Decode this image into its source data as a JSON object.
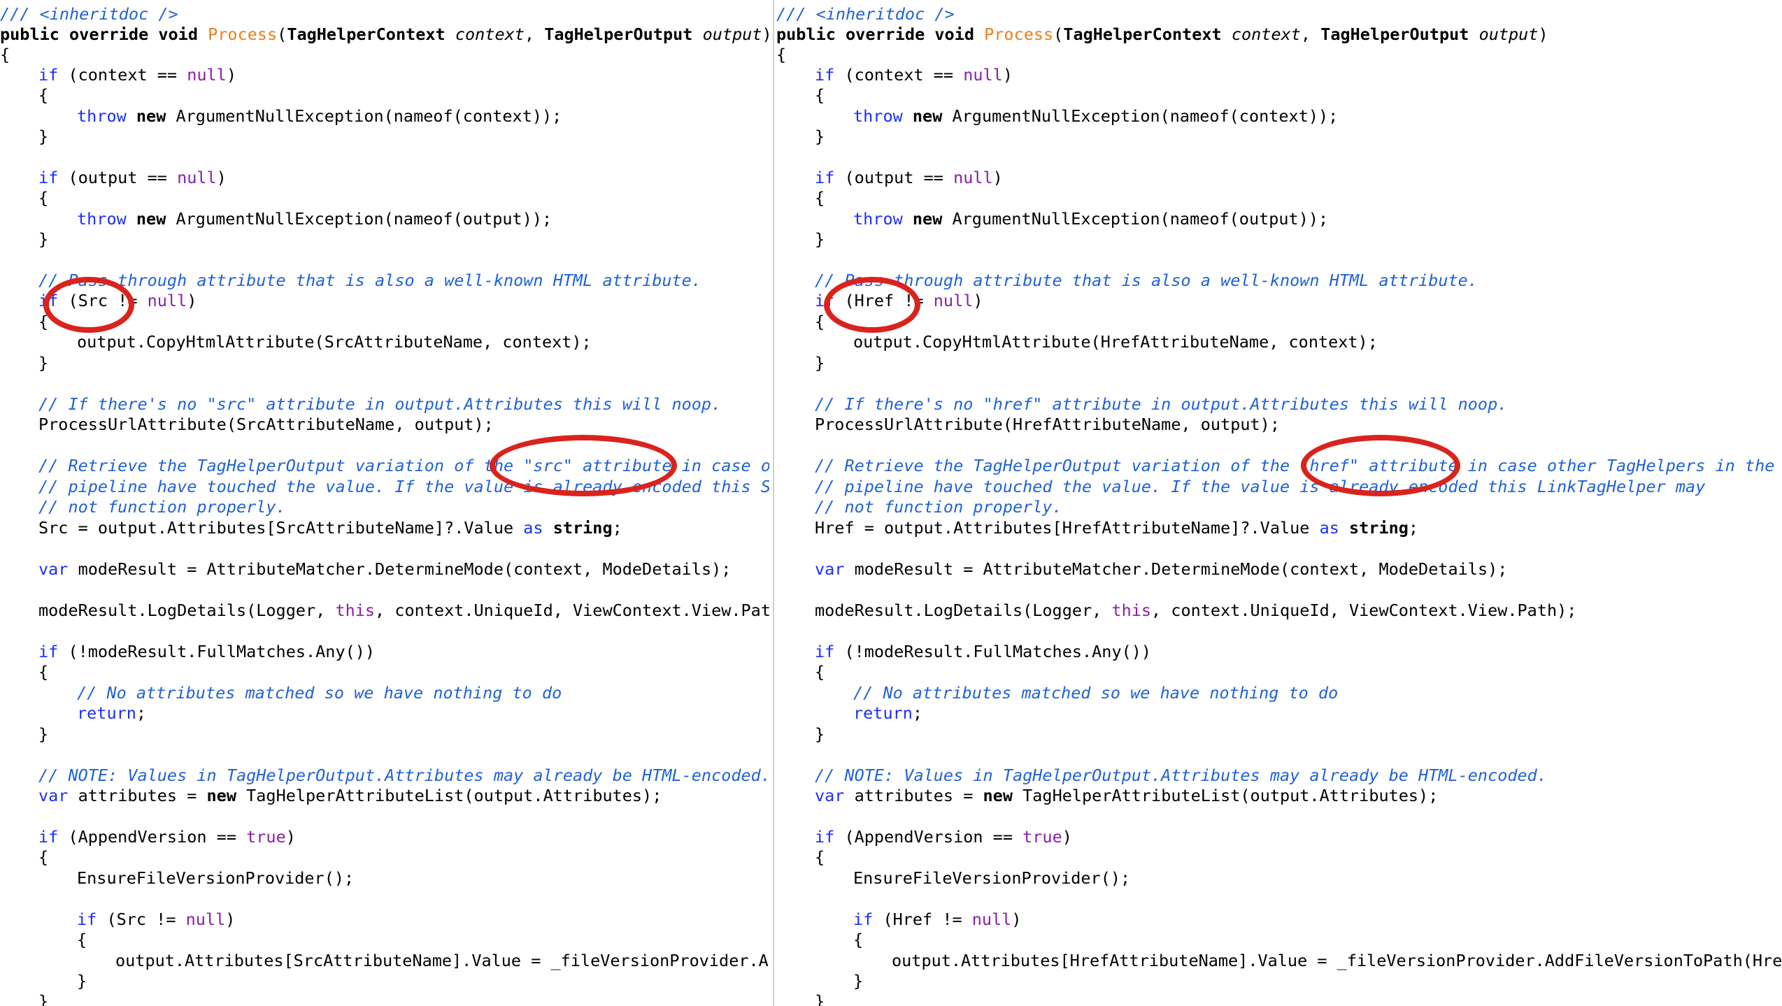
{
  "annotation_color": "#d9231c",
  "left": {
    "l00": "/// <inheritdoc />",
    "l01": [
      "public override void ",
      "Process",
      "(",
      "TagHelperContext",
      " context",
      ", ",
      "TagHelperOutput",
      " output",
      ")"
    ],
    "l02": "{",
    "l03": [
      "if",
      " (context == ",
      "null",
      ")"
    ],
    "l04": "{",
    "l05": [
      "throw",
      " ",
      "new",
      " ArgumentNullException(nameof(context));"
    ],
    "l06": "}",
    "l07": [
      "if",
      " (output == ",
      "null",
      ")"
    ],
    "l08": "{",
    "l09": [
      "throw",
      " ",
      "new",
      " ArgumentNullException(nameof(output));"
    ],
    "l10": "}",
    "l11": "// Pass through attribute that is also a well-known HTML attribute.",
    "l12": [
      "if",
      " (Src != ",
      "null",
      ")"
    ],
    "l13": "{",
    "l14": "output.CopyHtmlAttribute(SrcAttributeName, context);",
    "l15": "}",
    "l16": "// If there's no \"src\" attribute in output.Attributes this will noop.",
    "l17": "ProcessUrlAttribute(SrcAttributeName, output);",
    "l18": "// Retrieve the TagHelperOutput variation of the \"src\" attribute in case othe",
    "l19": "// pipeline have touched the value. If the value is already encoded this Scr",
    "l20": "// not function properly.",
    "l21": [
      "Src = output.Attributes[SrcAttributeName]?.Value ",
      "as",
      " ",
      "string",
      ";"
    ],
    "l22": [
      "var",
      " modeResult = AttributeMatcher.DetermineMode(context, ModeDetails);"
    ],
    "l23": [
      "modeResult.LogDetails(Logger, ",
      "this",
      ", context.UniqueId, ViewContext.View.Path);"
    ],
    "l24": [
      "if",
      " (!modeResult.FullMatches.Any())"
    ],
    "l25": "{",
    "l26": "// No attributes matched so we have nothing to do",
    "l27": [
      "return",
      ";"
    ],
    "l28": "}",
    "l29": "// NOTE: Values in TagHelperOutput.Attributes may already be HTML-encoded.",
    "l30": [
      "var",
      " attributes = ",
      "new",
      " TagHelperAttributeList(output.Attributes);"
    ],
    "l31": [
      "if",
      " (AppendVersion == ",
      "true",
      ")"
    ],
    "l32": "{",
    "l33": "EnsureFileVersionProvider();",
    "l34": [
      "if",
      " (Src != ",
      "null",
      ")"
    ],
    "l35": "{",
    "l36": "output.Attributes[SrcAttributeName].Value = _fileVersionProvider.AddF",
    "l37": "}",
    "l38": "}"
  },
  "right": {
    "l00": "/// <inheritdoc />",
    "l01": [
      "public override void ",
      "Process",
      "(",
      "TagHelperContext",
      " context",
      ", ",
      "TagHelperOutput",
      " output",
      ")"
    ],
    "l02": "{",
    "l03": [
      "if",
      " (context == ",
      "null",
      ")"
    ],
    "l04": "{",
    "l05": [
      "throw",
      " ",
      "new",
      " ArgumentNullException(nameof(context));"
    ],
    "l06": "}",
    "l07": [
      "if",
      " (output == ",
      "null",
      ")"
    ],
    "l08": "{",
    "l09": [
      "throw",
      " ",
      "new",
      " ArgumentNullException(nameof(output));"
    ],
    "l10": "}",
    "l11": "// Pass through attribute that is also a well-known HTML attribute.",
    "l12": [
      "if",
      " (Href != ",
      "null",
      ")"
    ],
    "l13": "{",
    "l14": "output.CopyHtmlAttribute(HrefAttributeName, context);",
    "l15": "}",
    "l16": "// If there's no \"href\" attribute in output.Attributes this will noop.",
    "l17": "ProcessUrlAttribute(HrefAttributeName, output);",
    "l18": "// Retrieve the TagHelperOutput variation of the \"href\" attribute in case other TagHelpers in the",
    "l19": "// pipeline have touched the value. If the value is already encoded this LinkTagHelper may",
    "l20": "// not function properly.",
    "l21": [
      "Href = output.Attributes[HrefAttributeName]?.Value ",
      "as",
      " ",
      "string",
      ";"
    ],
    "l22": [
      "var",
      " modeResult = AttributeMatcher.DetermineMode(context, ModeDetails);"
    ],
    "l23": [
      "modeResult.LogDetails(Logger, ",
      "this",
      ", context.UniqueId, ViewContext.View.Path);"
    ],
    "l24": [
      "if",
      " (!modeResult.FullMatches.Any())"
    ],
    "l25": "{",
    "l26": "// No attributes matched so we have nothing to do",
    "l27": [
      "return",
      ";"
    ],
    "l28": "}",
    "l29": "// NOTE: Values in TagHelperOutput.Attributes may already be HTML-encoded.",
    "l30": [
      "var",
      " attributes = ",
      "new",
      " TagHelperAttributeList(output.Attributes);"
    ],
    "l31": [
      "if",
      " (AppendVersion == ",
      "true",
      ")"
    ],
    "l32": "{",
    "l33": "EnsureFileVersionProvider();",
    "l34": [
      "if",
      " (Href != ",
      "null",
      ")"
    ],
    "l35": "{",
    "l36": "output.Attributes[HrefAttributeName].Value = _fileVersionProvider.AddFileVersionToPath(Href);",
    "l37": "}",
    "l38": "}"
  }
}
